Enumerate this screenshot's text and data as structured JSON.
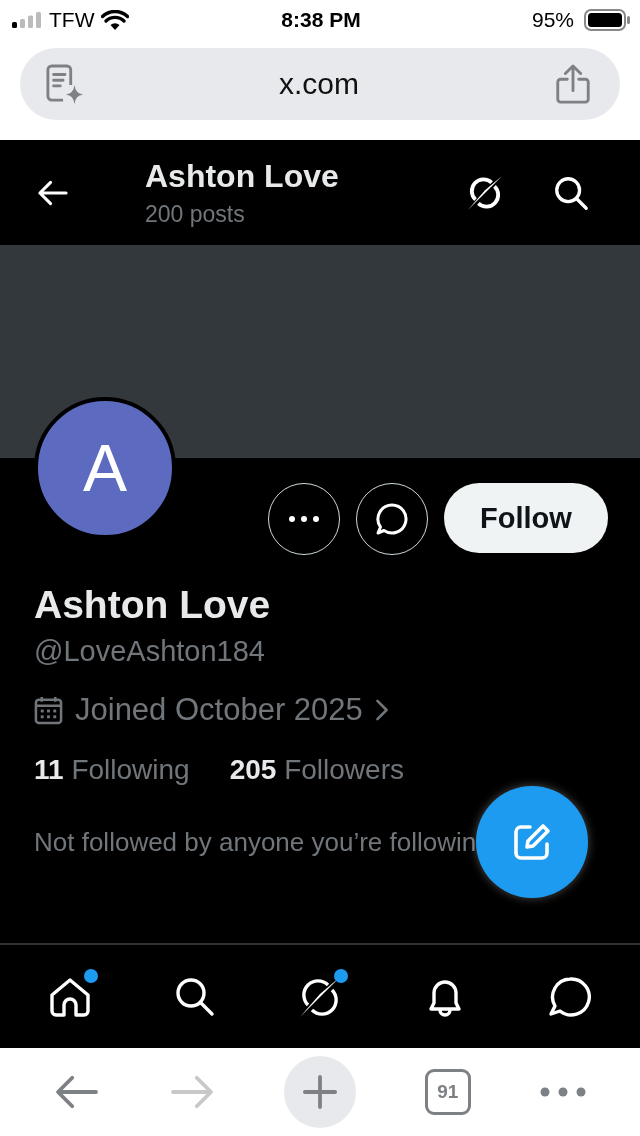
{
  "status_bar": {
    "carrier": "TFW",
    "time": "8:38 PM",
    "battery": "95%"
  },
  "browser": {
    "url": "x.com",
    "tabs_count": "91",
    "back_disabled": false,
    "forward_disabled": true
  },
  "header": {
    "title": "Ashton Love",
    "subtitle": "200 posts"
  },
  "profile": {
    "avatar_letter": "A",
    "follow_label": "Follow",
    "name": "Ashton Love",
    "handle": "@LoveAshton184",
    "joined": "Joined October 2025",
    "following_count": "11",
    "following_label": "Following",
    "followers_count": "205",
    "followers_label": "Followers",
    "note": "Not followed by anyone you’re followin"
  },
  "bottom_nav": [
    {
      "kind": "home",
      "badge": true,
      "selected": false
    },
    {
      "kind": "search",
      "badge": false,
      "selected": false
    },
    {
      "kind": "grok",
      "badge": true,
      "selected": false
    },
    {
      "kind": "notifications",
      "badge": false,
      "selected": false
    },
    {
      "kind": "messages",
      "badge": false,
      "selected": false
    }
  ]
}
